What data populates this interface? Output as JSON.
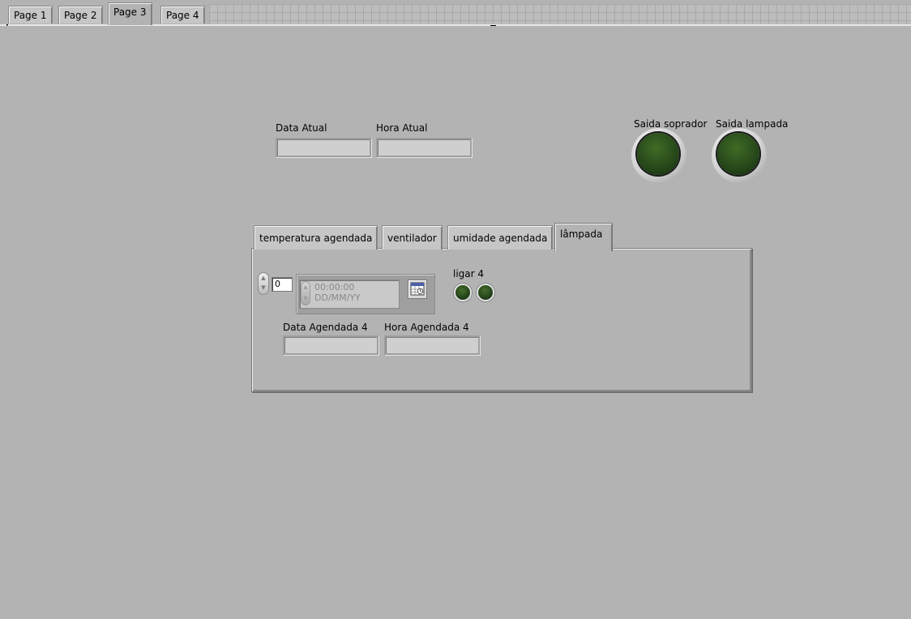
{
  "page_tabs": [
    {
      "label": "Page 1"
    },
    {
      "label": "Page 2"
    },
    {
      "label": "Page 3",
      "active": true
    },
    {
      "label": "Page 4"
    }
  ],
  "indicators": {
    "data_atual_label": "Data Atual",
    "hora_atual_label": "Hora Atual",
    "data_atual_value": "",
    "hora_atual_value": ""
  },
  "leds": {
    "soprador_label": "Saida soprador",
    "lampada_label": "Saida lampada",
    "color_off": "#26471a"
  },
  "tab_control": {
    "tabs": [
      {
        "label": "temperatura agendada"
      },
      {
        "label": "ventilador"
      },
      {
        "label": "umidade agendada"
      },
      {
        "label": "lâmpada",
        "active": true
      }
    ],
    "panel": {
      "array_index": "0",
      "timestamp_time": "00:00:00",
      "timestamp_date": "DD/MM/YY",
      "ligar_label": "ligar 4",
      "data_agendada_label": "Data Agendada 4",
      "hora_agendada_label": "Hora Agendada 4",
      "data_agendada_value": "",
      "hora_agendada_value": ""
    }
  },
  "icons": {
    "calendar_button": "calendar-icon",
    "increment": "up-arrow-icon",
    "decrement": "down-arrow-icon"
  },
  "colors": {
    "background": "#b3b3b3",
    "led_green": "#26471a"
  }
}
